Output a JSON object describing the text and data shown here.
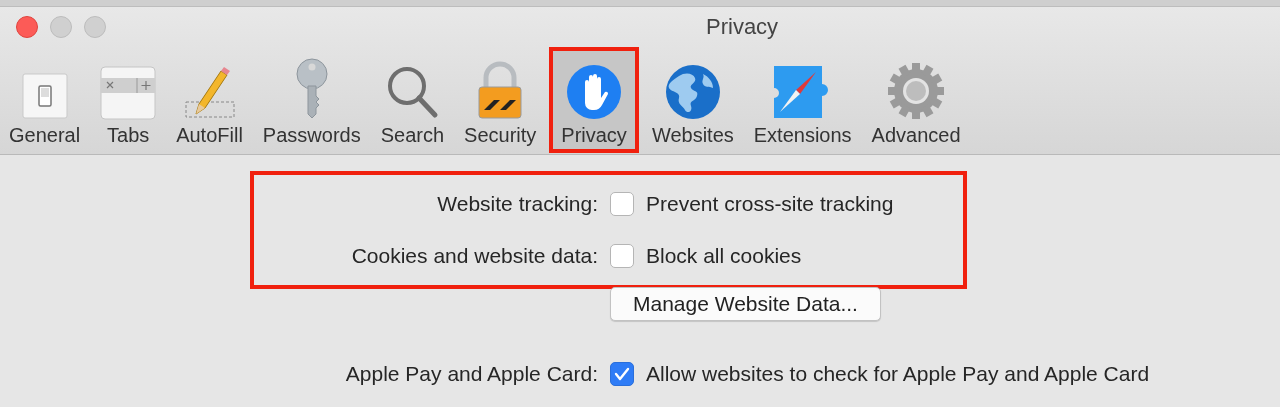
{
  "window": {
    "title": "Privacy",
    "close_active": true
  },
  "tabs": [
    {
      "label": "General",
      "selected": false,
      "highlighted": false
    },
    {
      "label": "Tabs",
      "selected": false,
      "highlighted": false
    },
    {
      "label": "AutoFill",
      "selected": false,
      "highlighted": false
    },
    {
      "label": "Passwords",
      "selected": false,
      "highlighted": false
    },
    {
      "label": "Search",
      "selected": false,
      "highlighted": false
    },
    {
      "label": "Security",
      "selected": false,
      "highlighted": false
    },
    {
      "label": "Privacy",
      "selected": true,
      "highlighted": true
    },
    {
      "label": "Websites",
      "selected": false,
      "highlighted": false
    },
    {
      "label": "Extensions",
      "selected": false,
      "highlighted": false
    },
    {
      "label": "Advanced",
      "selected": false,
      "highlighted": false
    }
  ],
  "sections": [
    {
      "highlighted": true,
      "rows": [
        {
          "kind": "checkbox",
          "label": "Website tracking:",
          "text": "Prevent cross-site tracking",
          "checked": false
        },
        {
          "kind": "checkbox",
          "label": "Cookies and website data:",
          "text": "Block all cookies",
          "checked": false
        }
      ]
    },
    {
      "highlighted": false,
      "rows": [
        {
          "kind": "button",
          "text": "Manage Website Data..."
        },
        {
          "kind": "checkbox",
          "label": "Apple Pay and Apple Card:",
          "text": "Allow websites to check for Apple Pay and Apple Card",
          "checked": true
        }
      ]
    }
  ]
}
